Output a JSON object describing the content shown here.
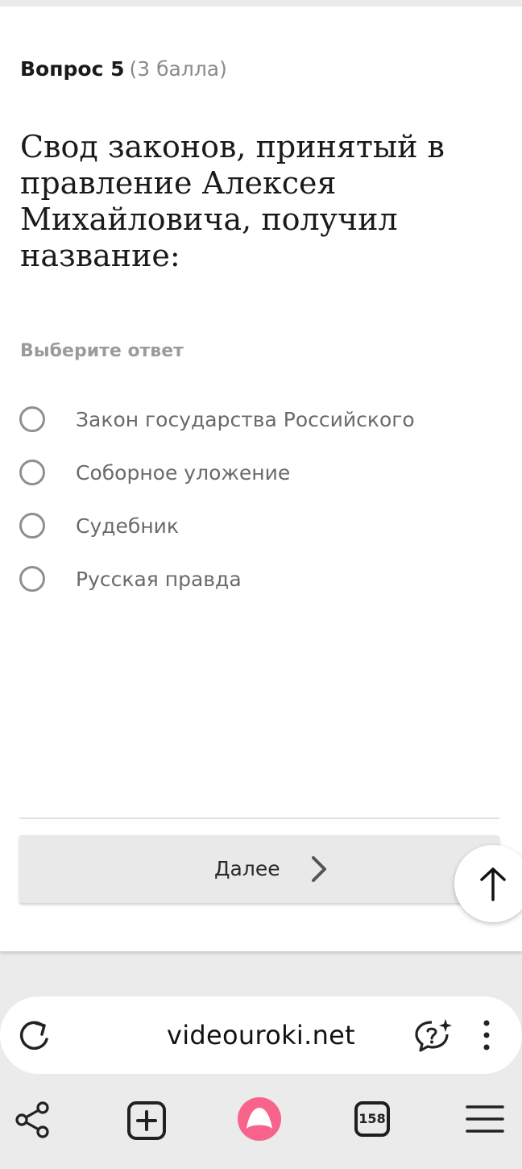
{
  "question": {
    "number_label": "Вопрос 5",
    "points_label": "(3 балла)",
    "text": "Свод законов, принятый в правление Алексея Михайловича, получил название:",
    "hint": "Выберите ответ",
    "options": [
      {
        "label": "Закон государства Российского",
        "selected": false
      },
      {
        "label": "Соборное уложение",
        "selected": false
      },
      {
        "label": "Судебник",
        "selected": false
      },
      {
        "label": "Русская правда",
        "selected": false
      }
    ],
    "next_label": "Далее"
  },
  "browser": {
    "url": "videouroki.net",
    "tabs_count": "158",
    "icons": [
      "reload-icon",
      "chat-question-icon",
      "more-vert-icon",
      "share-icon",
      "new-tab-icon",
      "alice-icon",
      "tabs-icon",
      "menu-icon",
      "arrow-up-icon",
      "chevron-right-icon"
    ],
    "accent_color": "#f7638a"
  }
}
